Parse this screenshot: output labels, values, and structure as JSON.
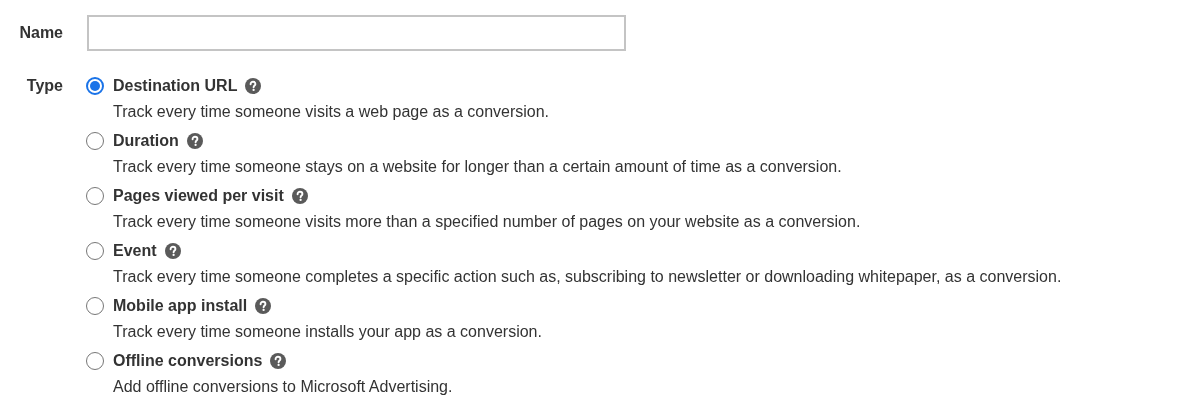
{
  "name_field": {
    "label": "Name"
  },
  "type_group": {
    "label": "Type",
    "options": [
      {
        "title": "Destination URL",
        "description": "Track every time someone visits a web page as a conversion.",
        "selected": true
      },
      {
        "title": "Duration",
        "description": "Track every time someone stays on a website for longer than a certain amount of time as a conversion.",
        "selected": false
      },
      {
        "title": "Pages viewed per visit",
        "description": "Track every time someone visits more than a specified number of pages on your website as a conversion.",
        "selected": false
      },
      {
        "title": "Event",
        "description": "Track every time someone completes a specific action such as, subscribing to newsletter or downloading whitepaper, as a conversion.",
        "selected": false
      },
      {
        "title": "Mobile app install",
        "description": "Track every time someone installs your app as a conversion.",
        "selected": false
      },
      {
        "title": "Offline conversions",
        "description": "Add offline conversions to Microsoft Advertising.",
        "selected": false
      }
    ]
  }
}
